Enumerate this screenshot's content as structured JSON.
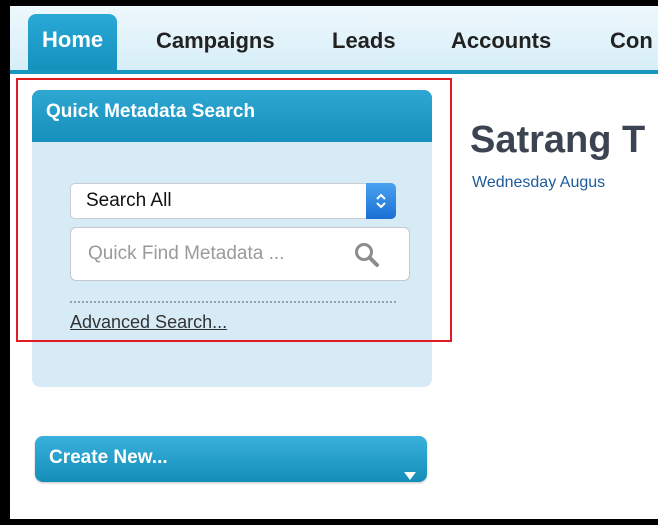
{
  "tabs": [
    {
      "label": "Home",
      "active": true
    },
    {
      "label": "Campaigns",
      "active": false
    },
    {
      "label": "Leads",
      "active": false
    },
    {
      "label": "Accounts",
      "active": false
    },
    {
      "label": "Con",
      "active": false
    }
  ],
  "sidebar": {
    "quick_search": {
      "header": "Quick Metadata Search",
      "scope_select": {
        "selected": "Search All",
        "icon": "updown-arrows-icon"
      },
      "search": {
        "placeholder": "Quick Find Metadata ...",
        "value": "",
        "icon": "search-icon"
      },
      "advanced_link": "Advanced Search..."
    },
    "create_new": {
      "label": "Create New...",
      "icon": "caret-down-icon"
    }
  },
  "main": {
    "title": "Satrang T",
    "date": "Wednesday Augus"
  },
  "colors": {
    "brand": "#1797c0",
    "highlight": "#e01b24",
    "panel_bg": "#d6ebf6",
    "link": "#1d5b9b"
  }
}
